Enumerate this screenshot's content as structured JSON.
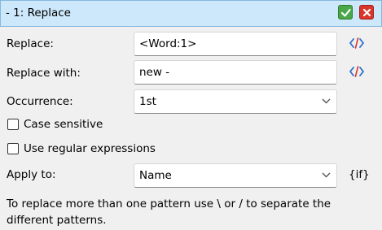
{
  "window": {
    "title": "-  1: Replace"
  },
  "fields": {
    "replace": {
      "label": "Replace:",
      "value": "<Word:1>"
    },
    "replace_with": {
      "label": "Replace with:",
      "value": "new -"
    },
    "occurrence": {
      "label": "Occurrence:",
      "value": "1st"
    },
    "apply_to": {
      "label": "Apply to:",
      "value": "Name"
    }
  },
  "options": {
    "case_sensitive": {
      "label": "Case sensitive",
      "checked": false
    },
    "regex": {
      "label": "Use regular expressions",
      "checked": false
    }
  },
  "if_label": "{if}",
  "note": "To replace more than one pattern use \\ or / to separate the different patterns.",
  "colors": {
    "titlebar": "#cde8fb",
    "accent_blue": "#2b6fc9",
    "ok_green": "#4aa84a",
    "close_red": "#d9352b"
  },
  "icons": [
    "checkmark-icon",
    "close-icon",
    "code-icon",
    "chevron-down-icon"
  ]
}
